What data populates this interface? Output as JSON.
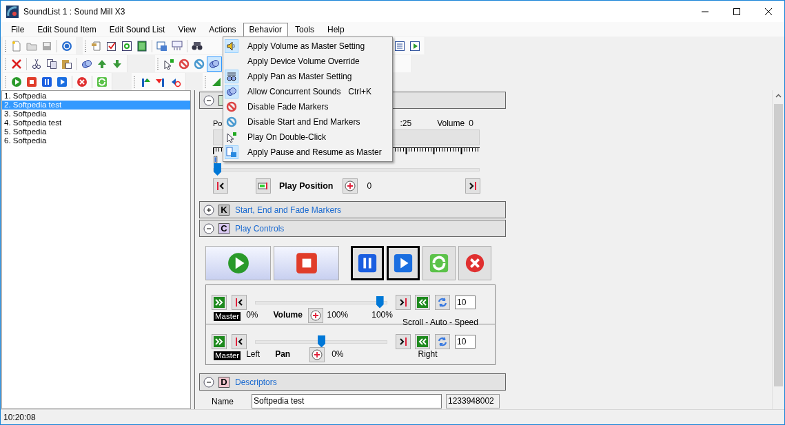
{
  "window": {
    "title": "SoundList 1 : Sound Mill X3"
  },
  "menu_bar": [
    {
      "label": "File",
      "selected": false
    },
    {
      "label": "Edit Sound Item",
      "selected": false
    },
    {
      "label": "Edit Sound List",
      "selected": false
    },
    {
      "label": "View",
      "selected": false
    },
    {
      "label": "Actions",
      "selected": false
    },
    {
      "label": "Behavior",
      "selected": true
    },
    {
      "label": "Tools",
      "selected": false
    },
    {
      "label": "Help",
      "selected": false
    }
  ],
  "behavior_menu": [
    {
      "label": "Apply Volume as Master Setting",
      "checked": true
    },
    {
      "label": "Apply Device Volume Override",
      "checked": false
    },
    {
      "label": "Apply Pan as Master Setting",
      "checked": true
    },
    {
      "label": "Allow Concurrent Sounds",
      "checked": true,
      "shortcut": "Ctrl+K"
    },
    {
      "label": "Disable Fade Markers",
      "checked": false
    },
    {
      "label": "Disable Start and End Markers",
      "checked": false
    },
    {
      "label": "Play On Double-Click",
      "checked": false
    },
    {
      "label": "Apply Pause and Resume as Master",
      "checked": true
    }
  ],
  "sound_list": [
    {
      "label": "1. Softpedia",
      "selected": false
    },
    {
      "label": "2. Softpedia test",
      "selected": true
    },
    {
      "label": "3. Softpedia",
      "selected": false
    },
    {
      "label": "4. Softpedia test",
      "selected": false
    },
    {
      "label": "5. Softpedia",
      "selected": false
    },
    {
      "label": "6. Softpedia",
      "selected": false
    }
  ],
  "position_panel": {
    "expanded": true,
    "color": "#cfe6cf",
    "position_label": "Po",
    "time": ":25",
    "volume_label": "Volume",
    "volume_value": "0",
    "level": 0,
    "play_position_label": "Play Position",
    "play_position_value": "0"
  },
  "sections": [
    {
      "letter": "K",
      "title": "Start, End and Fade Markers",
      "expanded": false,
      "color": "#c4c4c4"
    },
    {
      "letter": "C",
      "title": "Play Controls",
      "expanded": true,
      "color": "#d9c9f2"
    }
  ],
  "mix_rows": [
    {
      "badge": "Master",
      "min_label": "0%",
      "label": "Volume",
      "value": "100%",
      "max_label": "100%",
      "level": 0.97,
      "speed": "10",
      "note": "Scroll - Auto - Speed"
    },
    {
      "badge": "Master",
      "min_label": "Left",
      "label": "Pan",
      "value": "0%",
      "max_label": "Right",
      "level": 0.5,
      "speed": "10"
    }
  ],
  "descriptors_section": {
    "letter": "D",
    "title": "Descriptors",
    "expanded": true,
    "color": "#f2c6cf"
  },
  "descriptors": {
    "name_label": "Name",
    "name_value": "Softpedia test",
    "id_value": "1233948002"
  },
  "status_bar": {
    "time": "10:20:08"
  }
}
